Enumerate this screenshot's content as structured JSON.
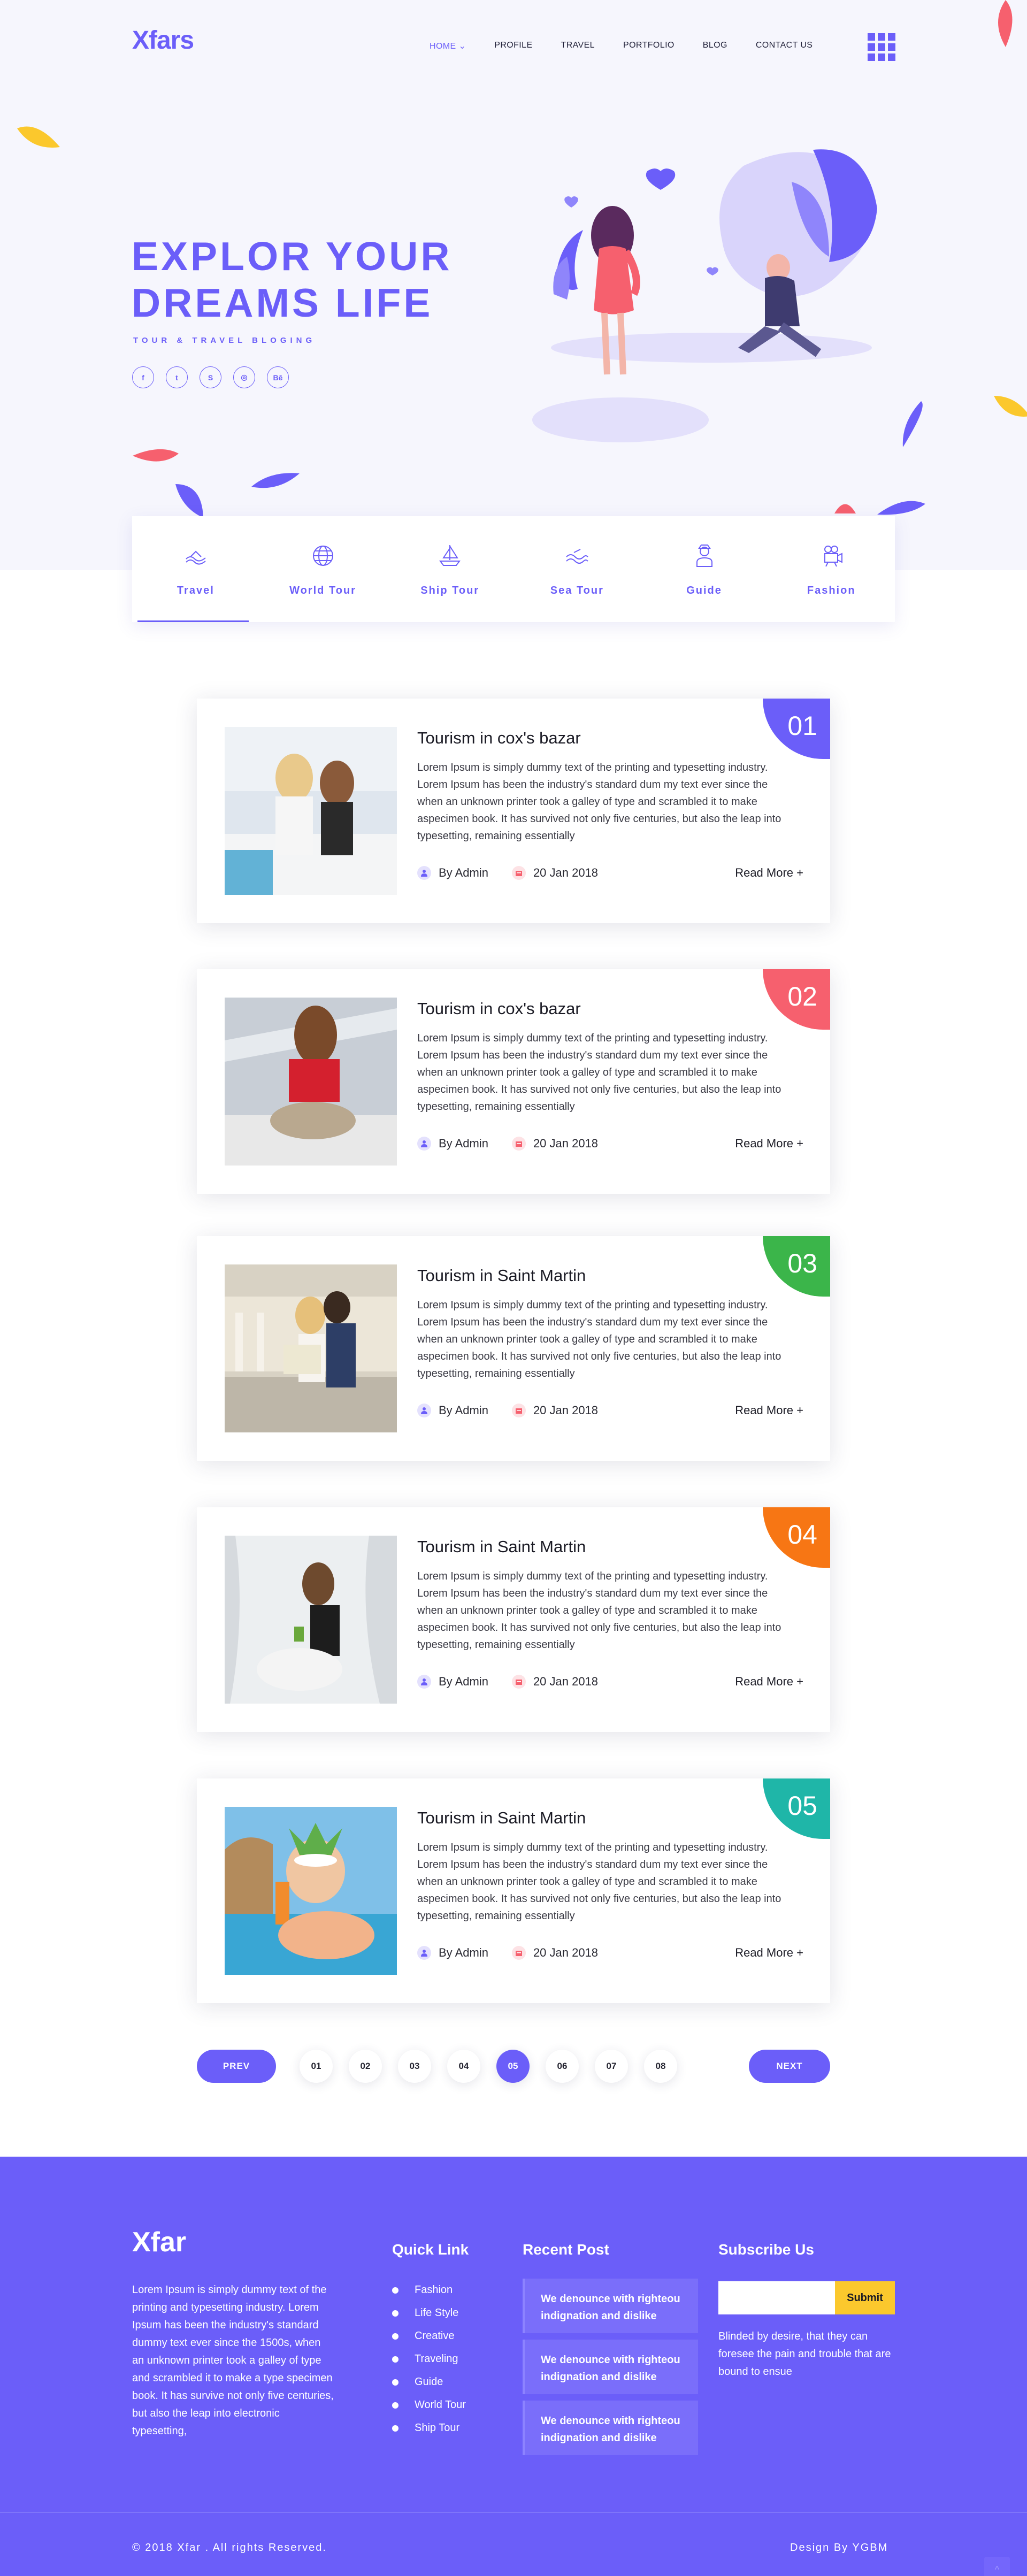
{
  "header": {
    "logo": "Xfars",
    "nav": [
      {
        "label": "HOME ⌄",
        "active": true
      },
      {
        "label": "PROFILE"
      },
      {
        "label": "TRAVEL"
      },
      {
        "label": "PORTFOLIO"
      },
      {
        "label": "BLOG"
      },
      {
        "label": "CONTACT US"
      }
    ]
  },
  "hero": {
    "title": "EXPLOR YOUR DREAMS LIFE",
    "subtitle": "TOUR & TRAVEL BLOGING",
    "socials": [
      "f",
      "t",
      "S",
      "◎",
      "Bē"
    ]
  },
  "categories": [
    {
      "label": "Travel",
      "icon": "travel-icon"
    },
    {
      "label": "World Tour",
      "icon": "globe-icon"
    },
    {
      "label": "Ship Tour",
      "icon": "ship-icon"
    },
    {
      "label": "Sea Tour",
      "icon": "wave-icon"
    },
    {
      "label": "Guide",
      "icon": "guide-icon"
    },
    {
      "label": "Fashion",
      "icon": "camera-icon"
    }
  ],
  "posts": [
    {
      "num": "01",
      "title": "Tourism in cox's bazar",
      "body": "Lorem Ipsum is simply dummy text of the printing and typesetting industry. Lorem Ipsum has been the industry's standard dum my text ever since the when an unknown printer took a galley of type and scrambled it to make aspecimen book. It has survived not only five centuries, but also the leap into typesetting, remaining essentially",
      "author": "By Admin",
      "date": "20 Jan 2018",
      "read": "Read More +",
      "color": "#6b5ef9"
    },
    {
      "num": "02",
      "title": "Tourism in cox's bazar",
      "body": "Lorem Ipsum is simply dummy text of the printing and typesetting industry. Lorem Ipsum has been the industry's standard dum my text ever since the when an unknown printer took a galley of type and scrambled it to make aspecimen book. It has survived not only five centuries, but also the leap into typesetting, remaining essentially",
      "author": "By Admin",
      "date": "20 Jan 2018",
      "read": "Read More +",
      "color": "#f6606e"
    },
    {
      "num": "03",
      "title": "Tourism in Saint Martin",
      "body": "Lorem Ipsum is simply dummy text of the printing and typesetting industry. Lorem Ipsum has been the industry's standard dum my text ever since the when an unknown printer took a galley of type and scrambled it to make aspecimen book. It has survived not only five centuries, but also the leap into typesetting, remaining essentially",
      "author": "By Admin",
      "date": "20 Jan 2018",
      "read": "Read More +",
      "color": "#3bb54a"
    },
    {
      "num": "04",
      "title": "Tourism in Saint Martin",
      "body": "Lorem Ipsum is simply dummy text of the printing and typesetting industry. Lorem Ipsum has been the industry's standard dum my text ever since the when an unknown printer took a galley of type and scrambled it to make aspecimen book. It has survived not only five centuries, but also the leap into typesetting, remaining essentially",
      "author": "By Admin",
      "date": "20 Jan 2018",
      "read": "Read More +",
      "color": "#f77614"
    },
    {
      "num": "05",
      "title": "Tourism in Saint Martin",
      "body": "Lorem Ipsum is simply dummy text of the printing and typesetting industry. Lorem Ipsum has been the industry's standard dum my text ever since the when an unknown printer took a galley of type and scrambled it to make aspecimen book. It has survived not only five centuries, but also the leap into typesetting, remaining essentially",
      "author": "By Admin",
      "date": "20 Jan 2018",
      "read": "Read More +",
      "color": "#1fb6a8"
    }
  ],
  "pagination": {
    "prev": "PREV",
    "next": "NEXT",
    "pages": [
      "01",
      "02",
      "03",
      "04",
      "05",
      "06",
      "07",
      "08"
    ],
    "current": "05"
  },
  "footer": {
    "logo": "Xfar",
    "about": "Lorem Ipsum is simply dummy text of the printing and typesetting industry. Lorem Ipsum has been the industry's standard dummy text ever since the 1500s, when an unknown printer took a galley of type and scrambled it to make a type specimen book. It has survive not only five centuries, but also the leap into electronic typesetting,",
    "quick_title": "Quick Link",
    "quick_links": [
      "Fashion",
      "Life Style",
      "Creative",
      "Traveling",
      "Guide",
      "World Tour",
      "Ship Tour"
    ],
    "recent_title": "Recent Post",
    "recent_posts": [
      "We denounce with righteou indignation and dislike",
      "We denounce with righteou indignation and dislike",
      "We denounce with righteou indignation and dislike"
    ],
    "subscribe_title": "Subscribe Us",
    "subscribe_button": "Submit",
    "subscribe_text": "Blinded by desire, that they can foresee the pain and trouble that are bound to ensue",
    "copyright": "© 2018 Xfar . All rights Reserved.",
    "design": "Design By YGBM",
    "totop": "^"
  },
  "colors": {
    "accent": "#6b5ef9",
    "yellow": "#fbc82d",
    "pink": "#f6606e"
  }
}
